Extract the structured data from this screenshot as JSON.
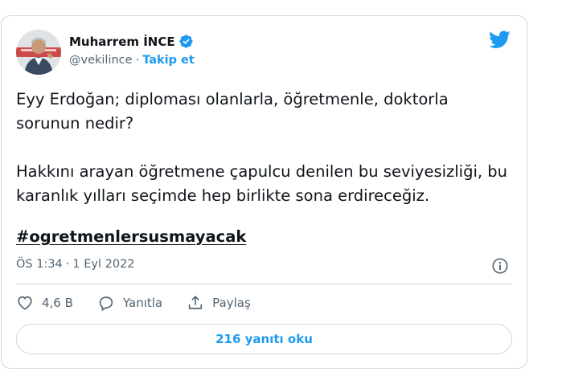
{
  "author": {
    "name": "Muharrem İNCE",
    "handle": "@vekilince",
    "separator": "·",
    "follow_label": "Takip et",
    "avatar": "profile-photo",
    "verified_icon": "verified-badge-icon"
  },
  "tweet": {
    "paragraphs": [
      "Eyy Erdoğan; diploması olanlarla, öğretmenle, doktorla sorunun nedir?",
      "Hakkını arayan öğretmene çapulcu denilen bu seviyesizliği, bu karanlık yılları seçimde hep birlikte sona erdireceğiz."
    ],
    "hashtag": "#ogretmenlersusmayacak",
    "time": "ÖS 1:34",
    "date_separator": "·",
    "date": "1 Eyl 2022"
  },
  "actions": {
    "like_count": "4,6 B",
    "reply_label": "Yanıtla",
    "share_label": "Paylaş"
  },
  "replies_button": "216 yanıtı oku",
  "colors": {
    "accent": "#1d9bf0",
    "text": "#0f1419",
    "muted": "#536471",
    "border": "#cfd9de"
  }
}
